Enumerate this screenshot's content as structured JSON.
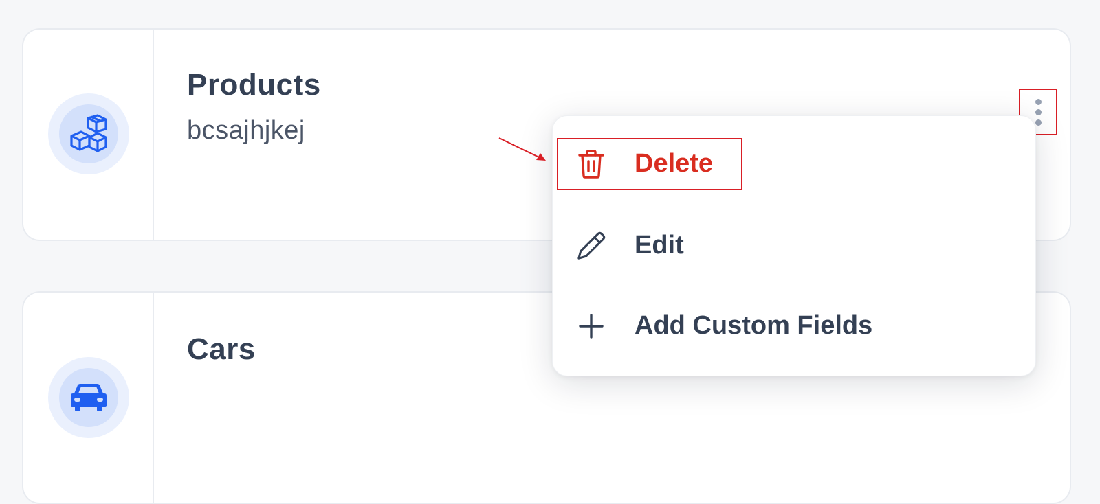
{
  "cards": [
    {
      "title": "Products",
      "description": "bcsajhjkej",
      "icon": "boxes-icon"
    },
    {
      "title": "Cars",
      "description": "",
      "icon": "car-icon"
    }
  ],
  "menu": {
    "items": [
      {
        "label": "Delete",
        "icon": "trash-icon",
        "color": "#d92d20"
      },
      {
        "label": "Edit",
        "icon": "pencil-icon",
        "color": "#344054"
      },
      {
        "label": "Add Custom Fields",
        "icon": "plus-icon",
        "color": "#344054"
      }
    ]
  },
  "colors": {
    "accent": "#2563eb",
    "annotation": "#d91f26",
    "text_primary": "#344054"
  }
}
